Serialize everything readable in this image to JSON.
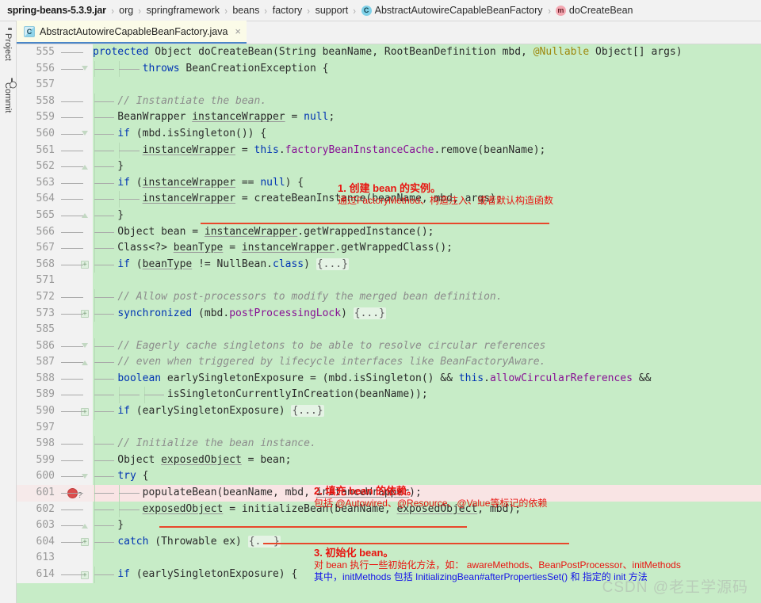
{
  "breadcrumb": {
    "items": [
      {
        "label": "spring-beans-5.3.9.jar",
        "icon": "",
        "kind": "jar"
      },
      {
        "label": "org",
        "icon": "",
        "kind": "pkg"
      },
      {
        "label": "springframework",
        "icon": "",
        "kind": "pkg"
      },
      {
        "label": "beans",
        "icon": "",
        "kind": "pkg"
      },
      {
        "label": "factory",
        "icon": "",
        "kind": "pkg"
      },
      {
        "label": "support",
        "icon": "",
        "kind": "pkg"
      },
      {
        "label": "AbstractAutowireCapableBeanFactory",
        "icon": "C",
        "kind": "class"
      },
      {
        "label": "doCreateBean",
        "icon": "m",
        "kind": "method"
      }
    ],
    "separator": "›"
  },
  "left_strip": {
    "project_label": "Project",
    "commit_label": "Commit"
  },
  "tab": {
    "filename": "AbstractAutowireCapableBeanFactory.java",
    "file_icon": "C",
    "close_glyph": "×"
  },
  "editor": {
    "background": "#c7ecc7",
    "gutter_background": "#f2f2f2",
    "highlight_row_color": "#f9e4e4",
    "breakpoint_color": "#db4c4c",
    "red_underline_color": "#e8472b",
    "lines": [
      {
        "num": "555",
        "text": "protected Object doCreateBean(String beanName, RootBeanDefinition mbd, @Nullable Object[] args)"
      },
      {
        "num": "556",
        "text": "\t\tthrows BeanCreationException {"
      },
      {
        "num": "557",
        "text": ""
      },
      {
        "num": "558",
        "text": "\t// Instantiate the bean."
      },
      {
        "num": "559",
        "text": "\tBeanWrapper instanceWrapper = null;"
      },
      {
        "num": "560",
        "text": "\tif (mbd.isSingleton()) {"
      },
      {
        "num": "561",
        "text": "\t\tinstanceWrapper = this.factoryBeanInstanceCache.remove(beanName);"
      },
      {
        "num": "562",
        "text": "\t}"
      },
      {
        "num": "563",
        "text": "\tif (instanceWrapper == null) {"
      },
      {
        "num": "564",
        "text": "\t\tinstanceWrapper = createBeanInstance(beanName, mbd, args);"
      },
      {
        "num": "565",
        "text": "\t}"
      },
      {
        "num": "566",
        "text": "\tObject bean = instanceWrapper.getWrappedInstance();"
      },
      {
        "num": "567",
        "text": "\tClass<?> beanType = instanceWrapper.getWrappedClass();"
      },
      {
        "num": "568",
        "text": "\tif (beanType != NullBean.class) {...}"
      },
      {
        "num": "571",
        "text": ""
      },
      {
        "num": "572",
        "text": "\t// Allow post-processors to modify the merged bean definition."
      },
      {
        "num": "573",
        "text": "\tsynchronized (mbd.postProcessingLock) {...}"
      },
      {
        "num": "585",
        "text": ""
      },
      {
        "num": "586",
        "text": "\t// Eagerly cache singletons to be able to resolve circular references"
      },
      {
        "num": "587",
        "text": "\t// even when triggered by lifecycle interfaces like BeanFactoryAware."
      },
      {
        "num": "588",
        "text": "\tboolean earlySingletonExposure = (mbd.isSingleton() && this.allowCircularReferences &&"
      },
      {
        "num": "589",
        "text": "\t\t\tisSingletonCurrentlyInCreation(beanName));"
      },
      {
        "num": "590",
        "text": "\tif (earlySingletonExposure) {...}"
      },
      {
        "num": "597",
        "text": ""
      },
      {
        "num": "598",
        "text": "\t// Initialize the bean instance."
      },
      {
        "num": "599",
        "text": "\tObject exposedObject = bean;"
      },
      {
        "num": "600",
        "text": "\ttry {"
      },
      {
        "num": "601",
        "text": "\t\tpopulateBean(beanName, mbd, instanceWrapper);"
      },
      {
        "num": "602",
        "text": "\t\texposedObject = initializeBean(beanName, exposedObject, mbd);"
      },
      {
        "num": "603",
        "text": "\t}"
      },
      {
        "num": "604",
        "text": "\tcatch (Throwable ex) {...}"
      },
      {
        "num": "613",
        "text": ""
      },
      {
        "num": "614",
        "text": "\tif (earlySingletonExposure) {"
      }
    ],
    "breakpoint_line": "601",
    "breakpoint_suffix": "?"
  },
  "annotations": [
    {
      "id": "annotation-1",
      "title": "1. 创建 bean 的实例。",
      "line2": "通过FactoryMethod、构造注入、或者默认构造函数",
      "line3": ""
    },
    {
      "id": "annotation-2",
      "title": "2. 填充 bean 的依赖。",
      "line2": "包括 @Autowired、@Resource、@Value等标记的依赖",
      "line3": ""
    },
    {
      "id": "annotation-3",
      "title": "3. 初始化 bean。",
      "line2": "对 bean 执行一些初始化方法，如： awareMethods、BeanPostProcessor、initMethods",
      "line3": "其中，initMethods 包括 InitializingBean#afterPropertiesSet() 和 指定的 init 方法"
    }
  ],
  "watermark": {
    "text": "CSDN @老王学源码"
  }
}
